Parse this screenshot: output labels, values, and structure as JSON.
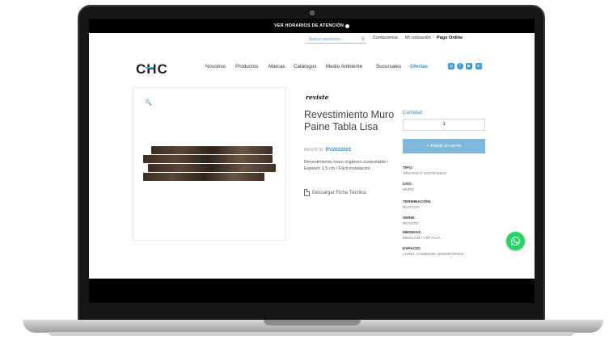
{
  "topbar": {
    "text": "VER HORARIOS DE ATENCIÓN"
  },
  "header": {
    "search_placeholder": "Buscar productos...",
    "links": [
      "Contáctenos",
      "Mi cotización",
      "Pago Online"
    ],
    "logo": "CHC"
  },
  "nav": {
    "items": [
      "Nosotros",
      "Productos",
      "Marcas",
      "Catálogos",
      "Medio Ambiente",
      "Sucursales",
      "Ofertas"
    ]
  },
  "social_icons": [
    "instagram-icon",
    "facebook-icon",
    "youtube-icon",
    "linkedin-icon"
  ],
  "product": {
    "brand": "reviste",
    "title": "Revestimiento Muro Paine Tabla Lisa",
    "brand_label": "REVISTE",
    "sku": "RV2022003",
    "description": "Revestimiento muro orgánico sustentable / Espesor 1,5 cm / Fácil instalación",
    "download_label": "Descargar Ficha Técnica"
  },
  "purchase": {
    "quantity_label": "Cantidad",
    "quantity_value": "1",
    "add_to_cart": "+ Añadir al carrito"
  },
  "specs": [
    {
      "label": "TIPO:",
      "value": "ORGÁNICO SOSTENIBLE"
    },
    {
      "label": "USO:",
      "value": "MURO"
    },
    {
      "label": "TERMINACIÓN:",
      "value": "RÚSTICO"
    },
    {
      "label": "SERIE:",
      "value": "REVISTE"
    },
    {
      "label": "MEDIDAS:",
      "value": "88X24 CM / 1 M² CAJA"
    },
    {
      "label": "ESPACIO:",
      "value": "LIVING, COMEDOR, DORMITORIOS"
    }
  ],
  "colors": {
    "accent": "#3a8fd0",
    "button": "#7fb8da",
    "whatsapp": "#25d366"
  }
}
